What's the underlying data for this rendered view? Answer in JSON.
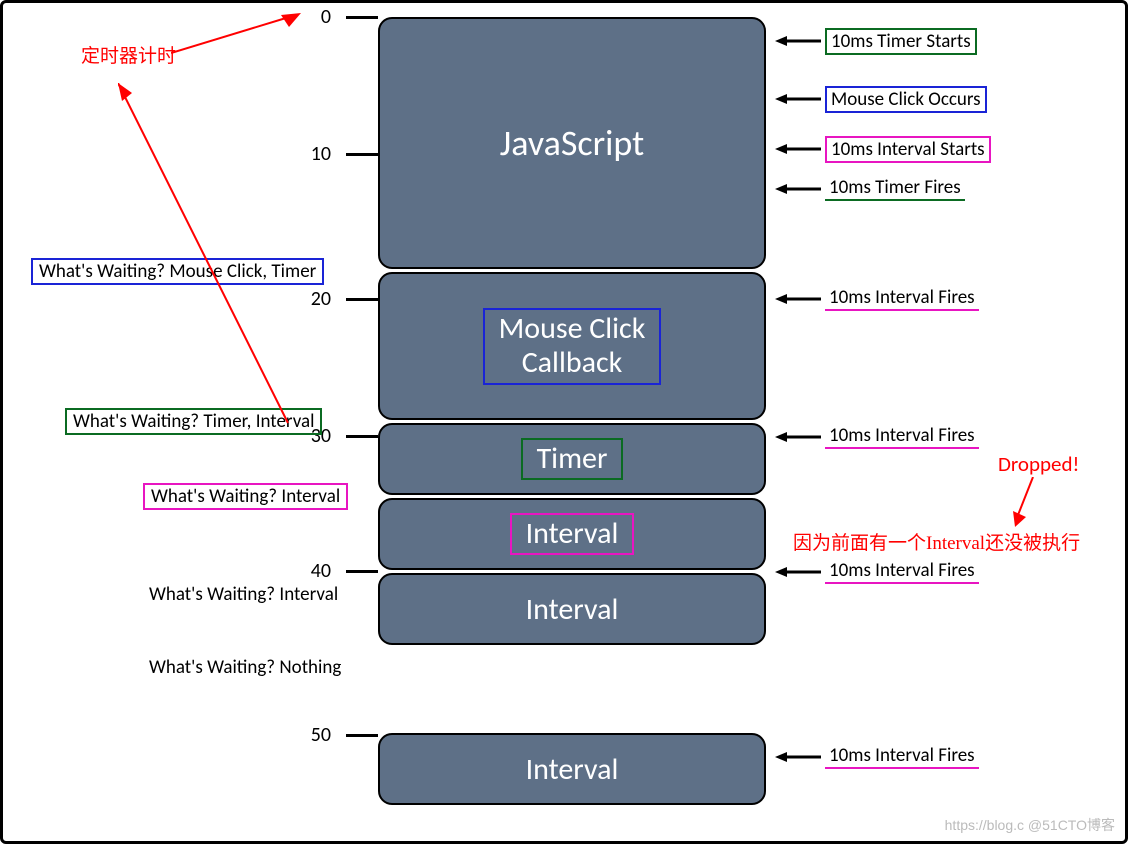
{
  "annotations": {
    "timer_label_cn": "定时器计时",
    "dropped": "Dropped!",
    "dropped_reason_cn": "因为前面有一个Interval还没被执行"
  },
  "ticks": {
    "t0": "0",
    "t10": "10",
    "t20": "20",
    "t30": "30",
    "t40": "40",
    "t50": "50"
  },
  "blocks": {
    "js": "JavaScript",
    "mouse": "Mouse Click\nCallback",
    "timer": "Timer",
    "interval1": "Interval",
    "interval2": "Interval",
    "interval3": "Interval"
  },
  "events": {
    "timer_starts": "10ms Timer Starts",
    "mouse_click": "Mouse Click Occurs",
    "interval_starts": "10ms Interval Starts",
    "timer_fires": "10ms Timer Fires",
    "interval_fires_1": "10ms Interval Fires",
    "interval_fires_2": "10ms Interval Fires",
    "interval_fires_3": "10ms Interval Fires",
    "interval_fires_4": "10ms Interval Fires"
  },
  "waiting": {
    "w1": "What's Waiting? Mouse Click, Timer",
    "w2": "What's Waiting? Timer, Interval",
    "w3": "What's Waiting? Interval",
    "w4": "What's Waiting? Interval",
    "w5": "What's Waiting? Nothing"
  },
  "colors": {
    "blue": "#1a24d6",
    "green": "#0b6b22",
    "magenta": "#e815c1",
    "red": "#ff0000"
  },
  "watermark": "https://blog.c @51CTO博客"
}
